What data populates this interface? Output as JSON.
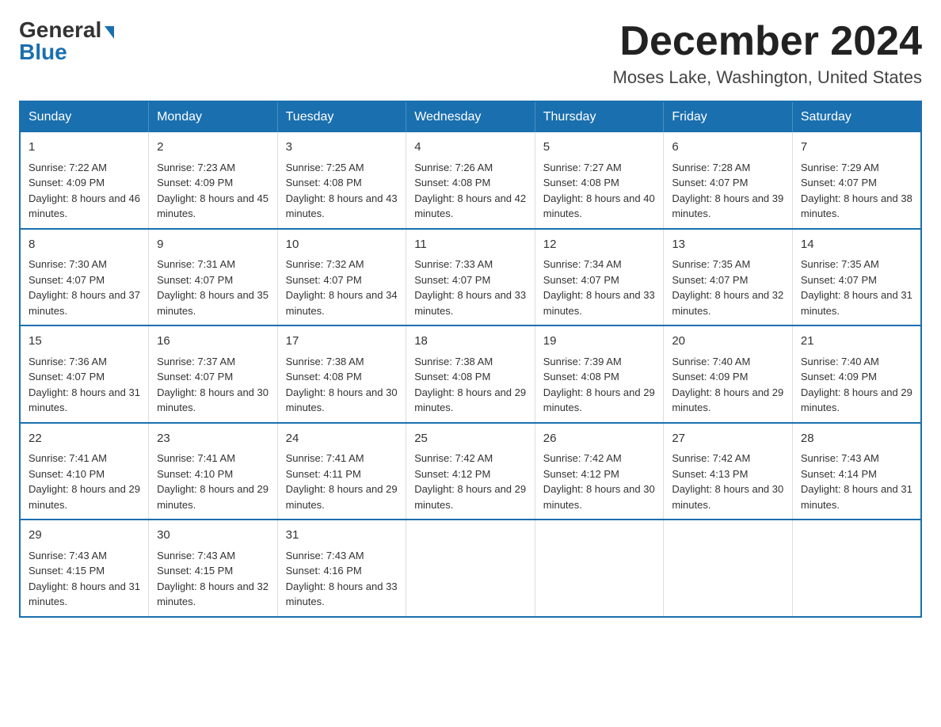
{
  "header": {
    "month_title": "December 2024",
    "location": "Moses Lake, Washington, United States",
    "logo_general": "General",
    "logo_blue": "Blue"
  },
  "weekdays": [
    "Sunday",
    "Monday",
    "Tuesday",
    "Wednesday",
    "Thursday",
    "Friday",
    "Saturday"
  ],
  "weeks": [
    [
      {
        "day": "1",
        "sunrise": "7:22 AM",
        "sunset": "4:09 PM",
        "daylight": "8 hours and 46 minutes."
      },
      {
        "day": "2",
        "sunrise": "7:23 AM",
        "sunset": "4:09 PM",
        "daylight": "8 hours and 45 minutes."
      },
      {
        "day": "3",
        "sunrise": "7:25 AM",
        "sunset": "4:08 PM",
        "daylight": "8 hours and 43 minutes."
      },
      {
        "day": "4",
        "sunrise": "7:26 AM",
        "sunset": "4:08 PM",
        "daylight": "8 hours and 42 minutes."
      },
      {
        "day": "5",
        "sunrise": "7:27 AM",
        "sunset": "4:08 PM",
        "daylight": "8 hours and 40 minutes."
      },
      {
        "day": "6",
        "sunrise": "7:28 AM",
        "sunset": "4:07 PM",
        "daylight": "8 hours and 39 minutes."
      },
      {
        "day": "7",
        "sunrise": "7:29 AM",
        "sunset": "4:07 PM",
        "daylight": "8 hours and 38 minutes."
      }
    ],
    [
      {
        "day": "8",
        "sunrise": "7:30 AM",
        "sunset": "4:07 PM",
        "daylight": "8 hours and 37 minutes."
      },
      {
        "day": "9",
        "sunrise": "7:31 AM",
        "sunset": "4:07 PM",
        "daylight": "8 hours and 35 minutes."
      },
      {
        "day": "10",
        "sunrise": "7:32 AM",
        "sunset": "4:07 PM",
        "daylight": "8 hours and 34 minutes."
      },
      {
        "day": "11",
        "sunrise": "7:33 AM",
        "sunset": "4:07 PM",
        "daylight": "8 hours and 33 minutes."
      },
      {
        "day": "12",
        "sunrise": "7:34 AM",
        "sunset": "4:07 PM",
        "daylight": "8 hours and 33 minutes."
      },
      {
        "day": "13",
        "sunrise": "7:35 AM",
        "sunset": "4:07 PM",
        "daylight": "8 hours and 32 minutes."
      },
      {
        "day": "14",
        "sunrise": "7:35 AM",
        "sunset": "4:07 PM",
        "daylight": "8 hours and 31 minutes."
      }
    ],
    [
      {
        "day": "15",
        "sunrise": "7:36 AM",
        "sunset": "4:07 PM",
        "daylight": "8 hours and 31 minutes."
      },
      {
        "day": "16",
        "sunrise": "7:37 AM",
        "sunset": "4:07 PM",
        "daylight": "8 hours and 30 minutes."
      },
      {
        "day": "17",
        "sunrise": "7:38 AM",
        "sunset": "4:08 PM",
        "daylight": "8 hours and 30 minutes."
      },
      {
        "day": "18",
        "sunrise": "7:38 AM",
        "sunset": "4:08 PM",
        "daylight": "8 hours and 29 minutes."
      },
      {
        "day": "19",
        "sunrise": "7:39 AM",
        "sunset": "4:08 PM",
        "daylight": "8 hours and 29 minutes."
      },
      {
        "day": "20",
        "sunrise": "7:40 AM",
        "sunset": "4:09 PM",
        "daylight": "8 hours and 29 minutes."
      },
      {
        "day": "21",
        "sunrise": "7:40 AM",
        "sunset": "4:09 PM",
        "daylight": "8 hours and 29 minutes."
      }
    ],
    [
      {
        "day": "22",
        "sunrise": "7:41 AM",
        "sunset": "4:10 PM",
        "daylight": "8 hours and 29 minutes."
      },
      {
        "day": "23",
        "sunrise": "7:41 AM",
        "sunset": "4:10 PM",
        "daylight": "8 hours and 29 minutes."
      },
      {
        "day": "24",
        "sunrise": "7:41 AM",
        "sunset": "4:11 PM",
        "daylight": "8 hours and 29 minutes."
      },
      {
        "day": "25",
        "sunrise": "7:42 AM",
        "sunset": "4:12 PM",
        "daylight": "8 hours and 29 minutes."
      },
      {
        "day": "26",
        "sunrise": "7:42 AM",
        "sunset": "4:12 PM",
        "daylight": "8 hours and 30 minutes."
      },
      {
        "day": "27",
        "sunrise": "7:42 AM",
        "sunset": "4:13 PM",
        "daylight": "8 hours and 30 minutes."
      },
      {
        "day": "28",
        "sunrise": "7:43 AM",
        "sunset": "4:14 PM",
        "daylight": "8 hours and 31 minutes."
      }
    ],
    [
      {
        "day": "29",
        "sunrise": "7:43 AM",
        "sunset": "4:15 PM",
        "daylight": "8 hours and 31 minutes."
      },
      {
        "day": "30",
        "sunrise": "7:43 AM",
        "sunset": "4:15 PM",
        "daylight": "8 hours and 32 minutes."
      },
      {
        "day": "31",
        "sunrise": "7:43 AM",
        "sunset": "4:16 PM",
        "daylight": "8 hours and 33 minutes."
      },
      null,
      null,
      null,
      null
    ]
  ]
}
